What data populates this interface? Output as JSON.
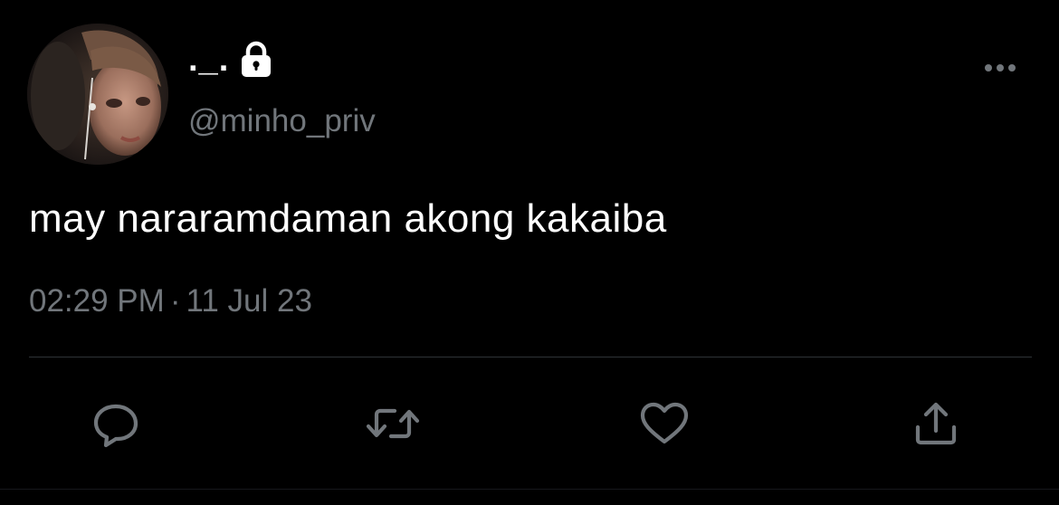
{
  "tweet": {
    "display_name": "._.",
    "handle": "@minho_priv",
    "text": "may nararamdaman akong kakaiba",
    "time": "02:29 PM",
    "separator": "·",
    "date": "11 Jul 23",
    "protected": true
  },
  "icons": {
    "lock": "lock-icon",
    "more": "more-horizontal-icon",
    "reply": "reply-icon",
    "retweet": "retweet-icon",
    "like": "heart-icon",
    "share": "share-icon"
  },
  "colors": {
    "background": "#000000",
    "primary_text": "#ffffff",
    "secondary_text": "#71767b",
    "divider": "#2f3336"
  }
}
